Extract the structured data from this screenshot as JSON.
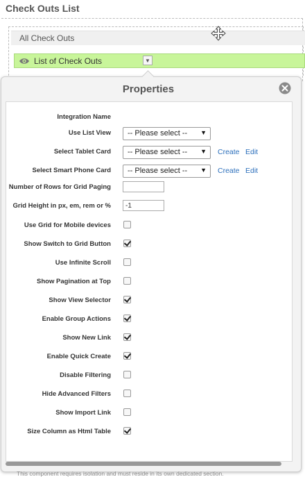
{
  "page": {
    "title": "Check Outs List"
  },
  "container": {
    "all_label": "All Check Outs",
    "list_label": "List of Check Outs"
  },
  "panel": {
    "title": "Properties",
    "close_icon": "close-icon",
    "fields": [
      {
        "label": "Integration Name"
      },
      {
        "label": "Use List View",
        "value": "-- Please select --"
      },
      {
        "label": "Select Tablet Card",
        "value": "-- Please select --",
        "create": "Create",
        "edit": "Edit"
      },
      {
        "label": "Select Smart Phone Card",
        "value": "-- Please select --",
        "create": "Create",
        "edit": "Edit"
      },
      {
        "label": "Number of Rows for Grid Paging",
        "value": ""
      },
      {
        "label": "Grid Height in px, em, rem or %",
        "value": "-1"
      }
    ],
    "checkboxes": [
      {
        "label": "Use Grid for Mobile devices",
        "checked": false
      },
      {
        "label": "Show Switch to Grid Button",
        "checked": true
      },
      {
        "label": "Use Infinite Scroll",
        "checked": false
      },
      {
        "label": "Show Pagination at Top",
        "checked": false
      },
      {
        "label": "Show View Selector",
        "checked": true
      },
      {
        "label": "Enable Group Actions",
        "checked": true
      },
      {
        "label": "Show New Link",
        "checked": true
      },
      {
        "label": "Enable Quick Create",
        "checked": true
      },
      {
        "label": "Disable Filtering",
        "checked": false
      },
      {
        "label": "Hide Advanced Filters",
        "checked": false
      },
      {
        "label": "Show Import Link",
        "checked": false
      },
      {
        "label": "Size Column as Html Table",
        "checked": true
      }
    ],
    "note": "This component requires isolation and must reside in its own dedicated section."
  },
  "colors": {
    "list_bar": "#c8f59a",
    "link": "#2a6ebb"
  }
}
